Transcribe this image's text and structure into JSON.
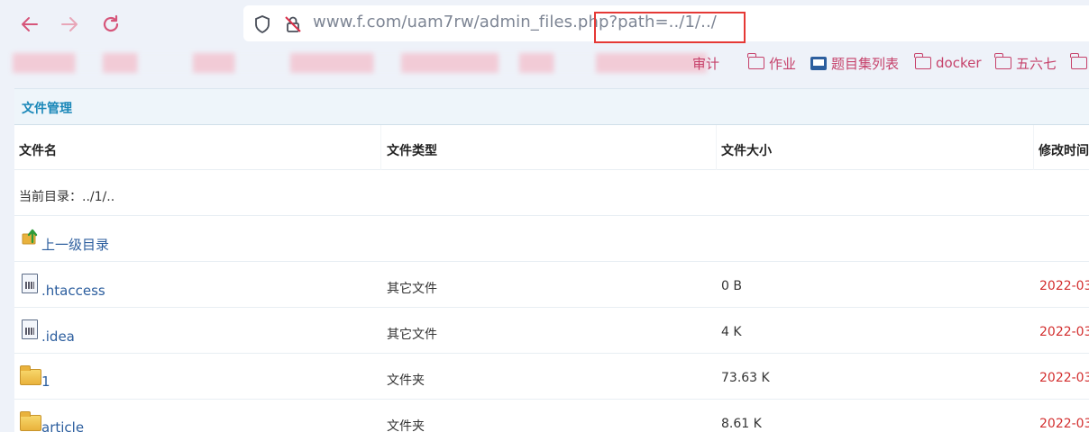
{
  "browser": {
    "url": "www.f.com/uam7rw/admin_files.php?path=../1/../",
    "nav": {
      "back_icon": "arrow-left-icon",
      "forward_icon": "arrow-right-icon",
      "reload_icon": "reload-icon"
    },
    "bookmarks": [
      {
        "label": "审计",
        "icon": "folder-icon"
      },
      {
        "label": "作业",
        "icon": "folder-icon"
      },
      {
        "label": "题目集列表",
        "icon": "page-icon"
      },
      {
        "label": "docker",
        "icon": "folder-icon"
      },
      {
        "label": "五六七",
        "icon": "folder-icon"
      }
    ],
    "colors": {
      "accent": "#c6426b",
      "highlight_box": "#e53935"
    }
  },
  "panel": {
    "title": "文件管理"
  },
  "table": {
    "headers": [
      "文件名",
      "文件类型",
      "文件大小",
      "修改时间"
    ],
    "current_dir_label": "当前目录：../1/..",
    "parent_dir_label": "上一级目录",
    "rows": [
      {
        "name": ".htaccess",
        "type": "其它文件",
        "size": "0 B",
        "date": "2022-03-",
        "icon": "file-icon"
      },
      {
        "name": ".idea",
        "type": "其它文件",
        "size": "4 K",
        "date": "2022-03-",
        "icon": "file-icon"
      },
      {
        "name": "1",
        "type": "文件夹",
        "size": "73.63 K",
        "date": "2022-03-",
        "icon": "folder-icon"
      },
      {
        "name": "article",
        "type": "文件夹",
        "size": "8.61 K",
        "date": "2022-03-",
        "icon": "folder-icon"
      }
    ]
  }
}
